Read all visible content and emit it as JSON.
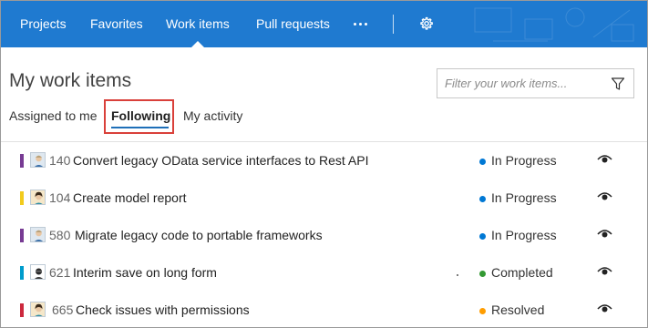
{
  "colors": {
    "topbar": "#1f7ad0",
    "active_tab_underline": "#1e6fb8",
    "highlight_border": "#d9403a"
  },
  "topnav": {
    "items": [
      {
        "label": "Projects"
      },
      {
        "label": "Favorites"
      },
      {
        "label": "Work items",
        "active": true
      },
      {
        "label": "Pull requests"
      }
    ],
    "more_icon": "ellipsis-icon",
    "settings_icon": "gear-icon"
  },
  "header": {
    "title": "My work items",
    "filter": {
      "placeholder": "Filter your work items...",
      "value": "",
      "icon": "filter-funnel-icon"
    }
  },
  "tabs": [
    {
      "label": "Assigned to me",
      "active": false
    },
    {
      "label": "Following",
      "active": true,
      "highlighted": true
    },
    {
      "label": "My activity",
      "active": false
    }
  ],
  "work_items": [
    {
      "id": "140",
      "title": "Convert legacy OData service interfaces to Rest API",
      "type_color": "#773b93",
      "state": "In Progress",
      "state_color": "#0078d4",
      "followed_icon": "eye-icon"
    },
    {
      "id": "104",
      "title": "Create model report",
      "type_color": "#f2cb1d",
      "state": "In Progress",
      "state_color": "#0078d4",
      "followed_icon": "eye-icon"
    },
    {
      "id": "580",
      "title": "Migrate legacy code to portable frameworks",
      "type_color": "#773b93",
      "state": "In Progress",
      "state_color": "#0078d4",
      "followed_icon": "eye-icon"
    },
    {
      "id": "621",
      "title": "Interim save on long form",
      "type_color": "#009ccc",
      "state": "Completed",
      "state_color": "#339933",
      "followed_icon": "eye-icon"
    },
    {
      "id": "665",
      "title": "Check issues with permissions",
      "type_color": "#cc293d",
      "state": "Resolved",
      "state_color": "#ff9d00",
      "followed_icon": "eye-icon"
    }
  ]
}
